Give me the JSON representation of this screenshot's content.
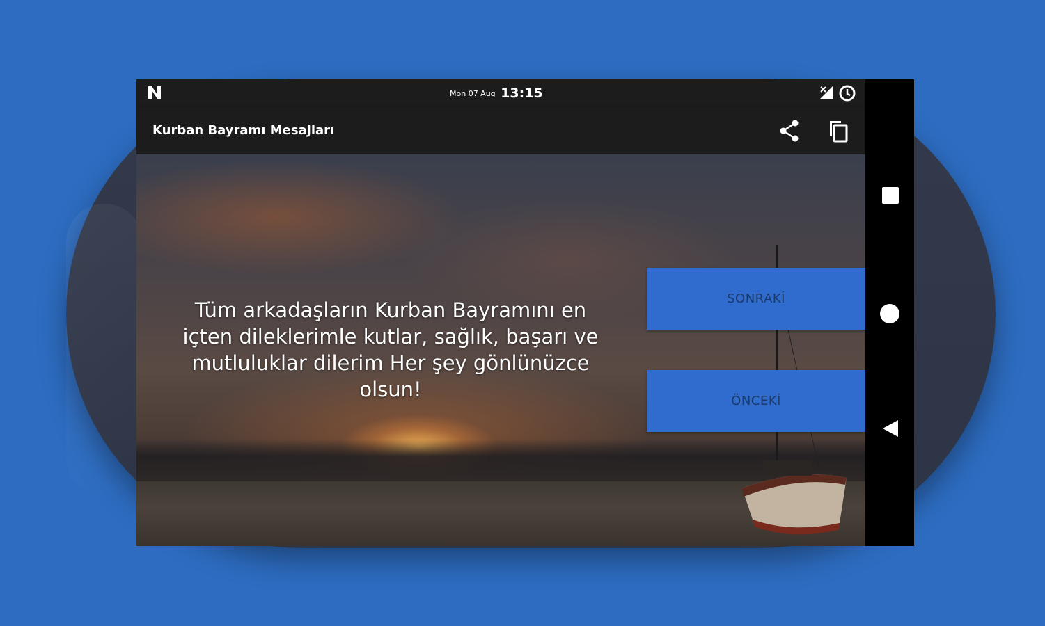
{
  "status_bar": {
    "date": "Mon 07 Aug",
    "time": "13:15"
  },
  "app_bar": {
    "title": "Kurban Bayramı Mesajları"
  },
  "message": {
    "text": "Tüm arkadaşların Kurban Bayramını en içten dileklerimle kutlar, sağlık, başarı ve mutluluklar dilerim Her şey gönlünüzce olsun!"
  },
  "buttons": {
    "next_label": "SONRAKİ",
    "prev_label": "ÖNCEKİ"
  },
  "icons": {
    "notification": "n-icon",
    "signal": "signal-icon",
    "alarm": "alarm-icon",
    "share": "share-icon",
    "copy": "copy-icon",
    "recents": "square-icon",
    "home": "circle-icon",
    "back": "triangle-icon"
  },
  "colors": {
    "background": "#2d6cc0",
    "button": "#2f6ccd",
    "button_text": "#1d3a6a",
    "toolbar": "#1c1c1c"
  }
}
